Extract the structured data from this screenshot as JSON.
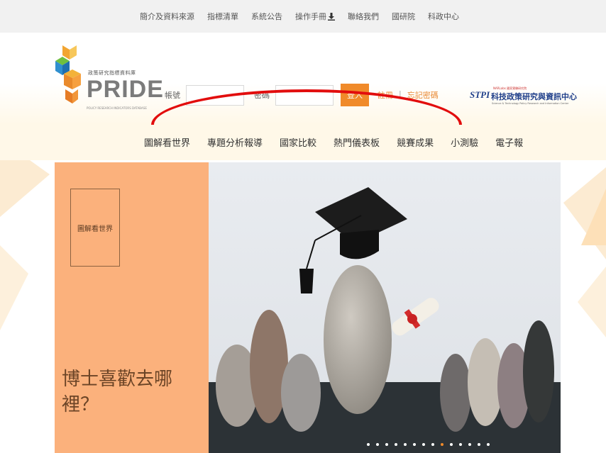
{
  "top_links": [
    {
      "label": "簡介及資料來源"
    },
    {
      "label": "指標清單"
    },
    {
      "label": "系統公告"
    },
    {
      "label": "操作手冊",
      "icon": "download-icon"
    },
    {
      "label": "聯絡我們"
    },
    {
      "label": "國研院"
    },
    {
      "label": "科政中心"
    }
  ],
  "logo": {
    "small_text": "政策研究指標資料庫",
    "word": "PRIDE",
    "tagline": "POLICY RESEARCH INDICATORS DATABASE"
  },
  "login": {
    "account_label": "帳號",
    "account_value": "",
    "password_label": "密碼",
    "password_value": "",
    "login_button": "登入",
    "register_link": "註冊",
    "separator": "|",
    "forgot_link": "忘記密碼"
  },
  "stpi": {
    "mark": "STPI",
    "small": "NARLabs 國家實驗研究院",
    "name": "科技政策研究與資訊中心",
    "en": "Science & Technology Policy Research and Information Center"
  },
  "nav": [
    {
      "label": "圖解看世界"
    },
    {
      "label": "專題分析報導"
    },
    {
      "label": "國家比較"
    },
    {
      "label": "熱門儀表板"
    },
    {
      "label": "競賽成果"
    },
    {
      "label": "小測驗"
    },
    {
      "label": "電子報"
    }
  ],
  "hero": {
    "tag": "圖解看世界",
    "title": "博士喜歡去哪裡？",
    "slide_count": 14,
    "active_slide": 8
  },
  "colors": {
    "accent": "#f08a2a",
    "hero_panel": "#fbb17c",
    "annotation": "#e20d0d"
  }
}
